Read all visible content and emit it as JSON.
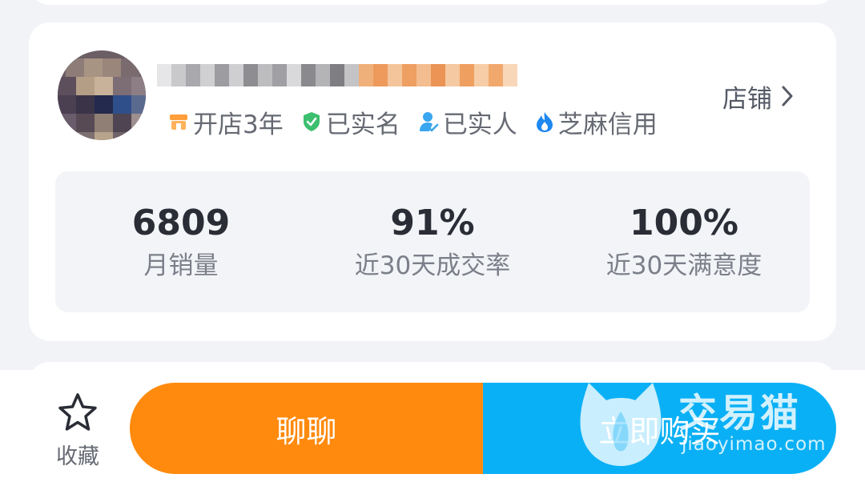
{
  "shop": {
    "link_label": "店铺",
    "tags": [
      {
        "label": "开店3年",
        "icon": "shop-icon",
        "color": "#ff9f3b"
      },
      {
        "label": "已实名",
        "icon": "shield-check-icon",
        "color": "#3cbf6e"
      },
      {
        "label": "已实人",
        "icon": "person-verified-icon",
        "color": "#3aa6f0"
      },
      {
        "label": "芝麻信用",
        "icon": "flame-icon",
        "color": "#1e88f0"
      }
    ]
  },
  "stats": [
    {
      "value": "6809",
      "label": "月销量"
    },
    {
      "value": "91%",
      "label": "近30天成交率"
    },
    {
      "value": "100%",
      "label": "近30天满意度"
    }
  ],
  "bottom_bar": {
    "favorite_label": "收藏",
    "chat_label": "聊聊",
    "buy_label": "立即购买"
  },
  "watermark": {
    "title": "交易猫",
    "url": "jiaoyimao.com"
  },
  "colors": {
    "chat_button": "#ff8a0d",
    "buy_button": "#0ab0f5",
    "page_background": "#f2f3f7"
  }
}
